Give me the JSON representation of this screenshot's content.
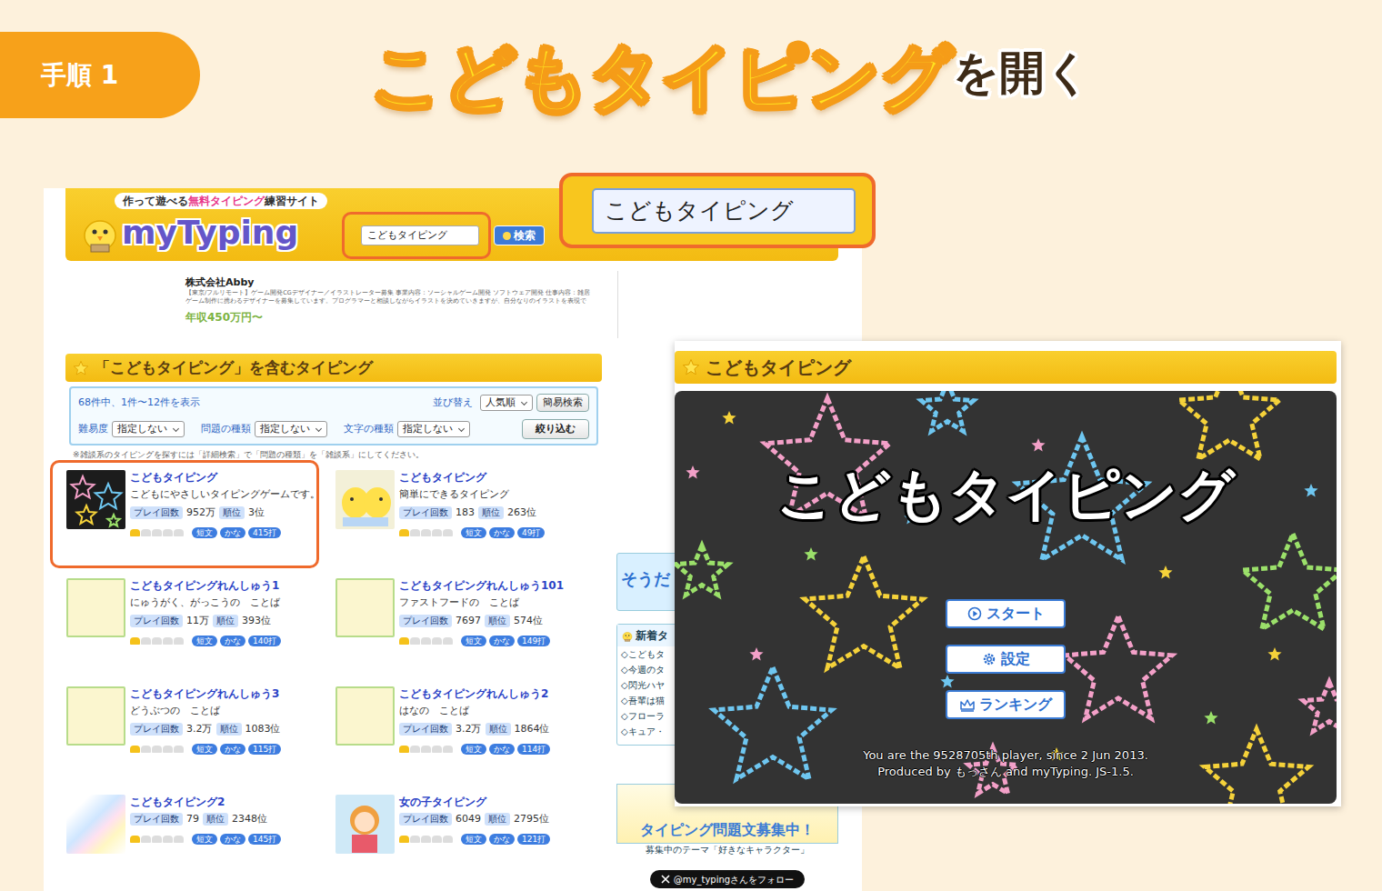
{
  "step": {
    "label": "手順 1"
  },
  "headline": {
    "highlight": "こどもタイピング",
    "rest": "を開く"
  },
  "site": {
    "tagline": [
      {
        "text": "作って遊べる",
        "highlight": false
      },
      {
        "text": "無料タイピング",
        "highlight": true
      },
      {
        "text": "練習サイト",
        "highlight": false
      }
    ],
    "logo": "myTyping",
    "search": {
      "value": "こどもタイピング",
      "button": "検索"
    },
    "callout": {
      "value": "こどもタイピング"
    },
    "ad": {
      "company": "株式会社Abby",
      "lines": [
        "【東京/フルリモート】ゲーム開発CGデザイナー／イラストレーター募集 事業内容：ソーシャルゲーム開発 ソフトウェア開発 仕事内容：雑居",
        "ゲーム制作に携わるデザイナーを募集しています。プログラマーと相談しながらイラストを決めていきますが、自分なりのイラストを表現で"
      ],
      "salary": "年収450万円〜"
    },
    "results": {
      "title": "「こどもタイピング」を含むタイピング",
      "count": "68件中、1件〜12件を表示",
      "sort_label": "並び替え",
      "sort_value": "人気順",
      "simple_search": "簡易検索",
      "filters": [
        {
          "label": "難易度",
          "value": "指定しない"
        },
        {
          "label": "問題の種類",
          "value": "指定しない"
        },
        {
          "label": "文字の種類",
          "value": "指定しない"
        }
      ],
      "filter_button": "絞り込む",
      "note": "※雑談系のタイピングを探すには「詳細検索」で「問題の種類」を「雑談系」にしてください。",
      "items": [
        {
          "title": "こどもタイピング",
          "desc": "こどもにやさしいタイピングゲームです。",
          "play_label": "プレイ回数",
          "plays": "952万",
          "rank_label": "順位",
          "rank": "3位",
          "stars": 1,
          "tags": [
            "短文",
            "かな",
            "415打"
          ],
          "thumb": "stars",
          "highlighted": true
        },
        {
          "title": "こどもタイピング",
          "desc": "簡単にできるタイピング",
          "play_label": "プレイ回数",
          "plays": "183",
          "rank_label": "順位",
          "rank": "263位",
          "stars": 1,
          "tags": [
            "短文",
            "かな",
            "49打"
          ],
          "thumb": "chick",
          "highlighted": false
        },
        {
          "title": "こどもタイピングれんしゅう1",
          "desc": "にゅうがく、がっこうの　ことば",
          "play_label": "プレイ回数",
          "plays": "11万",
          "rank_label": "順位",
          "rank": "393位",
          "stars": 1,
          "tags": [
            "短文",
            "かな",
            "140打"
          ],
          "thumb": "kodomo",
          "highlighted": false
        },
        {
          "title": "こどもタイピングれんしゅう101",
          "desc": "ファストフードの　ことば",
          "play_label": "プレイ回数",
          "plays": "7697",
          "rank_label": "順位",
          "rank": "574位",
          "stars": 1,
          "tags": [
            "短文",
            "かな",
            "149打"
          ],
          "thumb": "kodomo",
          "highlighted": false
        },
        {
          "title": "こどもタイピングれんしゅう3",
          "desc": "どうぶつの　ことば",
          "play_label": "プレイ回数",
          "plays": "3.2万",
          "rank_label": "順位",
          "rank": "1083位",
          "stars": 1,
          "tags": [
            "短文",
            "かな",
            "115打"
          ],
          "thumb": "kodomo",
          "highlighted": false
        },
        {
          "title": "こどもタイピングれんしゅう2",
          "desc": "はなの　ことば",
          "play_label": "プレイ回数",
          "plays": "3.2万",
          "rank_label": "順位",
          "rank": "1864位",
          "stars": 1,
          "tags": [
            "短文",
            "かな",
            "114打"
          ],
          "thumb": "kodomo",
          "highlighted": false
        },
        {
          "title": "こどもタイピング2",
          "play_label": "プレイ回数",
          "plays": "79",
          "rank_label": "順位",
          "rank": "2348位",
          "stars": 1,
          "tags": [
            "短文",
            "かな",
            "145打"
          ],
          "thumb": "rainbow",
          "highlighted": false
        },
        {
          "title": "女の子タイピング",
          "play_label": "プレイ回数",
          "plays": "6049",
          "rank_label": "順位",
          "rank": "2795位",
          "stars": 1,
          "tags": [
            "短文",
            "かな",
            "121打"
          ],
          "thumb": "girl",
          "highlighted": false
        }
      ]
    },
    "sidebar": {
      "banner": "そうだ",
      "new_title": "新着タ",
      "new_items": [
        "◇こどもタ",
        "◇今週のタ",
        "◇閃光ハヤ",
        "◇吾輩は猫",
        "◇フローラ",
        "◇キュア・"
      ],
      "recruit": "タイピング問題文募集中！",
      "theme": "募集中のテーマ「好きなキャラクター」",
      "follow": "@my_typingさんをフォロー"
    }
  },
  "game": {
    "title": "こどもタイピング",
    "screen_title": "こどもタイピング",
    "buttons": [
      {
        "label": "スタート",
        "kind": "play"
      },
      {
        "label": "設定",
        "kind": "gear"
      },
      {
        "label": "ランキング",
        "kind": "crown"
      }
    ],
    "footer": [
      "You are the 9528705th player, since 2 Jun 2013.",
      "Produced by もっさん and myTyping. JS-1.5."
    ]
  }
}
